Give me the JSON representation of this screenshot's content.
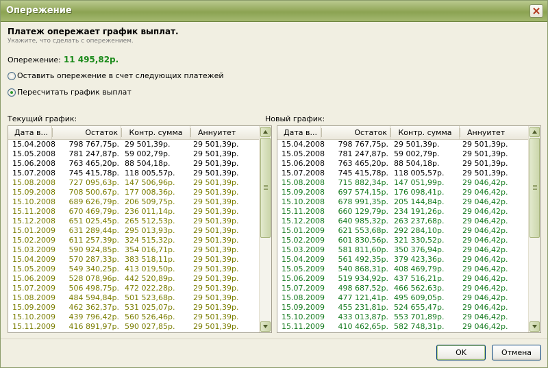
{
  "window": {
    "title": "Опережение"
  },
  "header": {
    "heading": "Платеж опережает график выплат.",
    "subheading": "Укажите, что сделать с опережением."
  },
  "advance": {
    "label": "Опережение:",
    "value": "11 495,82р."
  },
  "options": [
    {
      "label": "Оставить опережение в счет следующих платежей",
      "checked": false
    },
    {
      "label": "Пересчитать график выплат",
      "checked": true
    }
  ],
  "columns": [
    "Дата в...",
    "Остаток",
    "Контр. сумма",
    "Аннуитет"
  ],
  "current_grid": {
    "caption": "Текущий график:",
    "rows": [
      [
        "15.04.2008",
        "798 767,75р.",
        "29 501,39р.",
        "29 501,39р."
      ],
      [
        "15.05.2008",
        "781 247,87р.",
        "59 002,79р.",
        "29 501,39р."
      ],
      [
        "15.06.2008",
        "763 465,20р.",
        "88 504,18р.",
        "29 501,39р."
      ],
      [
        "15.07.2008",
        "745 415,78р.",
        "118 005,57р.",
        "29 501,39р."
      ],
      [
        "15.08.2008",
        "727 095,63р.",
        "147 506,96р.",
        "29 501,39р."
      ],
      [
        "15.09.2008",
        "708 500,67р.",
        "177 008,36р.",
        "29 501,39р."
      ],
      [
        "15.10.2008",
        "689 626,79р.",
        "206 509,75р.",
        "29 501,39р."
      ],
      [
        "15.11.2008",
        "670 469,79р.",
        "236 011,14р.",
        "29 501,39р."
      ],
      [
        "15.12.2008",
        "651 025,45р.",
        "265 512,53р.",
        "29 501,39р."
      ],
      [
        "15.01.2009",
        "631 289,44р.",
        "295 013,93р.",
        "29 501,39р."
      ],
      [
        "15.02.2009",
        "611 257,39р.",
        "324 515,32р.",
        "29 501,39р."
      ],
      [
        "15.03.2009",
        "590 924,85р.",
        "354 016,71р.",
        "29 501,39р."
      ],
      [
        "15.04.2009",
        "570 287,33р.",
        "383 518,11р.",
        "29 501,39р."
      ],
      [
        "15.05.2009",
        "549 340,25р.",
        "413 019,50р.",
        "29 501,39р."
      ],
      [
        "15.06.2009",
        "528 078,96р.",
        "442 520,89р.",
        "29 501,39р."
      ],
      [
        "15.07.2009",
        "506 498,75р.",
        "472 022,28р.",
        "29 501,39р."
      ],
      [
        "15.08.2009",
        "484 594,84р.",
        "501 523,68р.",
        "29 501,39р."
      ],
      [
        "15.09.2009",
        "462 362,37р.",
        "531 025,07р.",
        "29 501,39р."
      ],
      [
        "15.10.2009",
        "439 796,42р.",
        "560 526,46р.",
        "29 501,39р."
      ],
      [
        "15.11.2009",
        "416 891,97р.",
        "590 027,85р.",
        "29 501,39р."
      ]
    ]
  },
  "new_grid": {
    "caption": "Новый график:",
    "rows": [
      [
        "15.04.2008",
        "798 767,75р.",
        "29 501,39р.",
        "29 501,39р."
      ],
      [
        "15.05.2008",
        "781 247,87р.",
        "59 002,79р.",
        "29 501,39р."
      ],
      [
        "15.06.2008",
        "763 465,20р.",
        "88 504,18р.",
        "29 501,39р."
      ],
      [
        "15.07.2008",
        "745 415,78р.",
        "118 005,57р.",
        "29 501,39р."
      ],
      [
        "15.08.2008",
        "715 882,34р.",
        "147 051,99р.",
        "29 046,42р."
      ],
      [
        "15.09.2008",
        "697 574,15р.",
        "176 098,41р.",
        "29 046,42р."
      ],
      [
        "15.10.2008",
        "678 991,35р.",
        "205 144,84р.",
        "29 046,42р."
      ],
      [
        "15.11.2008",
        "660 129,79р.",
        "234 191,26р.",
        "29 046,42р."
      ],
      [
        "15.12.2008",
        "640 985,32р.",
        "263 237,68р.",
        "29 046,42р."
      ],
      [
        "15.01.2009",
        "621 553,68р.",
        "292 284,10р.",
        "29 046,42р."
      ],
      [
        "15.02.2009",
        "601 830,56р.",
        "321 330,52р.",
        "29 046,42р."
      ],
      [
        "15.03.2009",
        "581 811,60р.",
        "350 376,94р.",
        "29 046,42р."
      ],
      [
        "15.04.2009",
        "561 492,35р.",
        "379 423,36р.",
        "29 046,42р."
      ],
      [
        "15.05.2009",
        "540 868,31р.",
        "408 469,79р.",
        "29 046,42р."
      ],
      [
        "15.06.2009",
        "519 934,92р.",
        "437 516,21р.",
        "29 046,42р."
      ],
      [
        "15.07.2009",
        "498 687,52р.",
        "466 562,63р.",
        "29 046,42р."
      ],
      [
        "15.08.2009",
        "477 121,41р.",
        "495 609,05р.",
        "29 046,42р."
      ],
      [
        "15.09.2009",
        "455 231,81р.",
        "524 655,47р.",
        "29 046,42р."
      ],
      [
        "15.10.2009",
        "433 013,87р.",
        "553 701,89р.",
        "29 046,42р."
      ],
      [
        "15.11.2009",
        "410 462,65р.",
        "582 748,31р.",
        "29 046,42р."
      ]
    ]
  },
  "paid_rows": 4,
  "buttons": {
    "ok": "OK",
    "cancel": "Отмена"
  },
  "colors": {
    "accent_value": "#1a8a1a",
    "future_old": "#7a7d00",
    "future_new": "#13791d"
  }
}
